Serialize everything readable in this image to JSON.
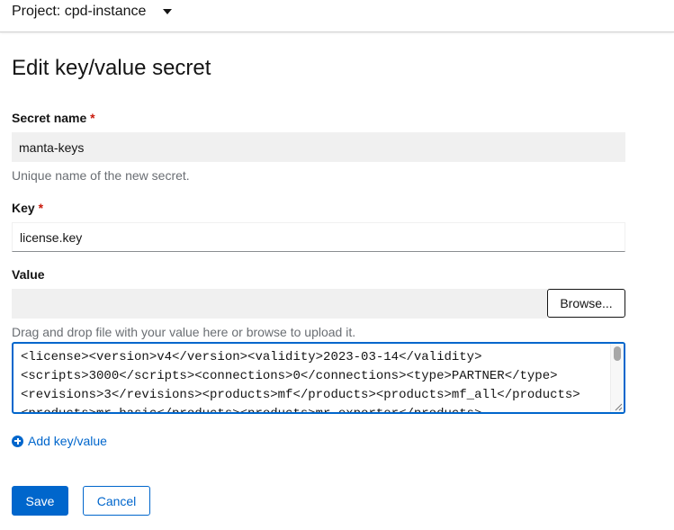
{
  "header": {
    "project_label": "Project: cpd-instance"
  },
  "page": {
    "title": "Edit key/value secret"
  },
  "form": {
    "secret_name": {
      "label": "Secret name",
      "required_marker": "*",
      "value": "manta-keys",
      "helper": "Unique name of the new secret."
    },
    "key": {
      "label": "Key",
      "required_marker": "*",
      "value": "license.key"
    },
    "value": {
      "label": "Value",
      "browse_label": "Browse...",
      "helper": "Drag and drop file with your value here or browse to upload it.",
      "text": "<license><version>v4</version><validity>2023-03-14</validity>\n<scripts>3000</scripts><connections>0</connections><type>PARTNER</type>\n<revisions>3</revisions><products>mf</products><products>mf_all</products>\n<products>mr_basic</products><products>mr_exporter</products>"
    },
    "add_label": "Add key/value"
  },
  "actions": {
    "save_label": "Save",
    "cancel_label": "Cancel"
  },
  "colors": {
    "accent": "#0066cc",
    "required": "#c9190b",
    "readonly_bg": "#f0f0f0"
  },
  "icons": {
    "project_toggle": "caret-down-icon",
    "add": "plus-circle-icon"
  }
}
